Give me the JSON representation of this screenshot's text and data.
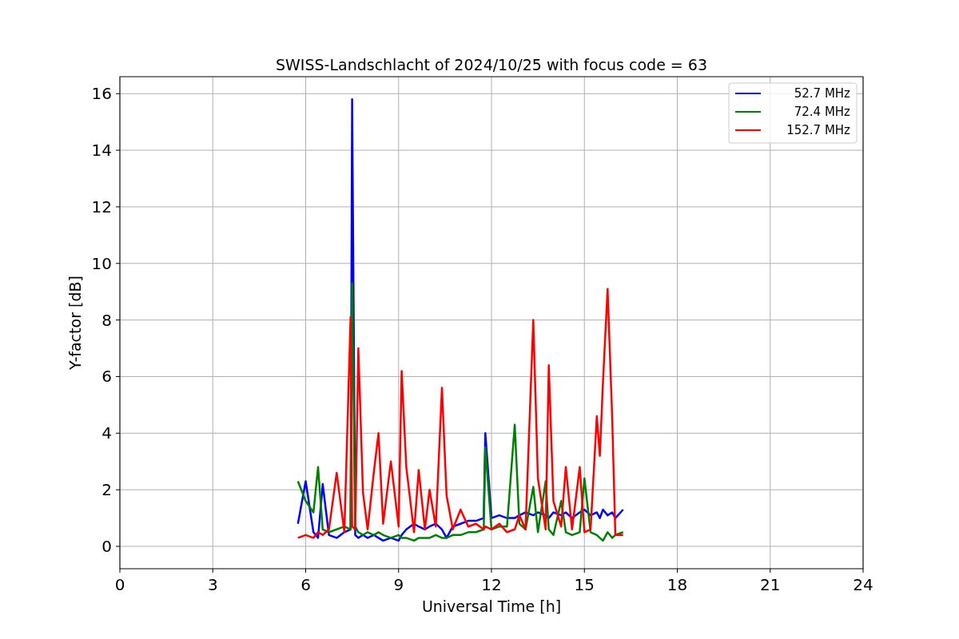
{
  "chart_data": {
    "type": "line",
    "title": "SWISS-Landschlacht of 2024/10/25 with focus code = 63",
    "xlabel": "Universal Time [h]",
    "ylabel": "Y-factor [dB]",
    "x": [
      5.75,
      6.0,
      6.25,
      6.4,
      6.55,
      6.75,
      7.0,
      7.25,
      7.45,
      7.5,
      7.6,
      7.7,
      7.85,
      8.0,
      8.2,
      8.35,
      8.5,
      8.75,
      9.0,
      9.1,
      9.25,
      9.5,
      9.65,
      9.85,
      10.0,
      10.2,
      10.4,
      10.55,
      10.75,
      11.0,
      11.25,
      11.5,
      11.75,
      11.8,
      12.0,
      12.25,
      12.5,
      12.75,
      12.9,
      13.1,
      13.35,
      13.5,
      13.75,
      13.85,
      14.0,
      14.25,
      14.4,
      14.6,
      14.85,
      15.0,
      15.2,
      15.4,
      15.5,
      15.6,
      15.75,
      15.9,
      16.0,
      16.25
    ],
    "series": [
      {
        "name": "52.7 MHz",
        "color": "#0000ff",
        "values": [
          0.8,
          2.3,
          0.5,
          0.3,
          2.2,
          0.4,
          0.3,
          0.5,
          0.6,
          15.8,
          0.4,
          0.3,
          0.4,
          0.3,
          0.4,
          0.3,
          0.2,
          0.3,
          0.2,
          0.4,
          0.6,
          0.8,
          0.7,
          0.6,
          0.7,
          0.8,
          0.6,
          0.3,
          0.7,
          0.8,
          0.9,
          0.9,
          1.0,
          4.0,
          1.0,
          1.1,
          1.0,
          1.0,
          1.1,
          1.2,
          1.1,
          1.2,
          1.1,
          1.0,
          1.2,
          1.1,
          1.2,
          1.0,
          1.2,
          1.3,
          1.1,
          1.2,
          1.0,
          1.3,
          1.1,
          1.2,
          1.0,
          1.3
        ]
      },
      {
        "name": "72.4 MHz",
        "color": "#008000",
        "values": [
          2.3,
          1.6,
          1.2,
          2.8,
          0.6,
          0.5,
          0.6,
          0.7,
          0.6,
          9.3,
          0.7,
          0.5,
          0.4,
          0.5,
          0.4,
          0.5,
          0.4,
          0.3,
          0.4,
          0.3,
          0.3,
          0.2,
          0.3,
          0.3,
          0.3,
          0.4,
          0.3,
          0.3,
          0.4,
          0.4,
          0.5,
          0.5,
          0.6,
          3.5,
          0.6,
          0.7,
          0.7,
          4.3,
          0.8,
          0.6,
          2.1,
          0.5,
          2.3,
          0.6,
          0.4,
          1.6,
          0.5,
          0.4,
          0.5,
          2.4,
          0.5,
          0.4,
          0.3,
          0.2,
          0.5,
          0.3,
          0.4,
          0.5
        ]
      },
      {
        "name": "152.7 MHz",
        "color": "#ff0000",
        "values": [
          0.3,
          0.4,
          0.3,
          0.5,
          0.4,
          0.6,
          2.6,
          0.5,
          8.1,
          0.7,
          0.6,
          7.0,
          1.9,
          0.6,
          2.6,
          4.0,
          0.8,
          3.0,
          0.7,
          6.2,
          2.8,
          0.5,
          2.7,
          0.6,
          2.0,
          0.7,
          5.6,
          1.8,
          0.6,
          1.3,
          0.7,
          0.8,
          0.6,
          0.7,
          0.6,
          0.8,
          0.5,
          0.6,
          1.1,
          0.6,
          8.0,
          2.4,
          0.6,
          6.4,
          1.6,
          0.7,
          2.8,
          0.6,
          2.8,
          0.5,
          0.6,
          4.6,
          3.2,
          5.8,
          9.1,
          4.5,
          0.4,
          0.4
        ]
      }
    ],
    "xlim": [
      0,
      24
    ],
    "ylim": [
      -0.79,
      16.6
    ],
    "grid": true,
    "xticks": [
      0,
      3,
      6,
      9,
      12,
      15,
      18,
      21,
      24
    ],
    "yticks": [
      0,
      2,
      4,
      6,
      8,
      10,
      12,
      14,
      16
    ]
  }
}
